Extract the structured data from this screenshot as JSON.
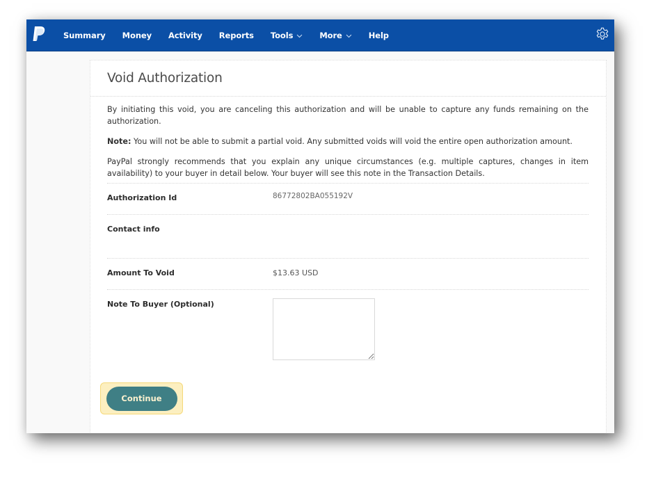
{
  "navbar": {
    "items": [
      {
        "label": "Summary",
        "dropdown": false
      },
      {
        "label": "Money",
        "dropdown": false
      },
      {
        "label": "Activity",
        "dropdown": false
      },
      {
        "label": "Reports",
        "dropdown": false
      },
      {
        "label": "Tools",
        "dropdown": true
      },
      {
        "label": "More",
        "dropdown": true
      },
      {
        "label": "Help",
        "dropdown": false
      }
    ],
    "logo_icon": "paypal-logo-icon",
    "settings_icon": "gear-icon",
    "bg_color": "#0b4fa6"
  },
  "page": {
    "title": "Void Authorization",
    "intro": "By initiating this void, you are canceling this authorization and will be unable to capture any funds remaining on the authorization.",
    "note_label": "Note:",
    "note_text": " You will not be able to submit a partial void. Any submitted voids will void the entire open authorization amount.",
    "recommend": "PayPal strongly recommends that you explain any unique circumstances (e.g. multiple captures, changes in item availability) to your buyer in detail below. Your buyer will see this note in the Transaction Details."
  },
  "fields": {
    "authorization_id": {
      "label": "Authorization Id",
      "value": "86772802BA055192V"
    },
    "contact_info": {
      "label": "Contact info",
      "value": ""
    },
    "amount": {
      "label": "Amount To Void",
      "value": "$13.63 USD"
    },
    "note": {
      "label": "Note To Buyer (Optional)",
      "value": "",
      "placeholder": ""
    }
  },
  "actions": {
    "continue_label": "Continue",
    "button_color": "#3f7f85",
    "highlight_color": "#fcefc0"
  }
}
